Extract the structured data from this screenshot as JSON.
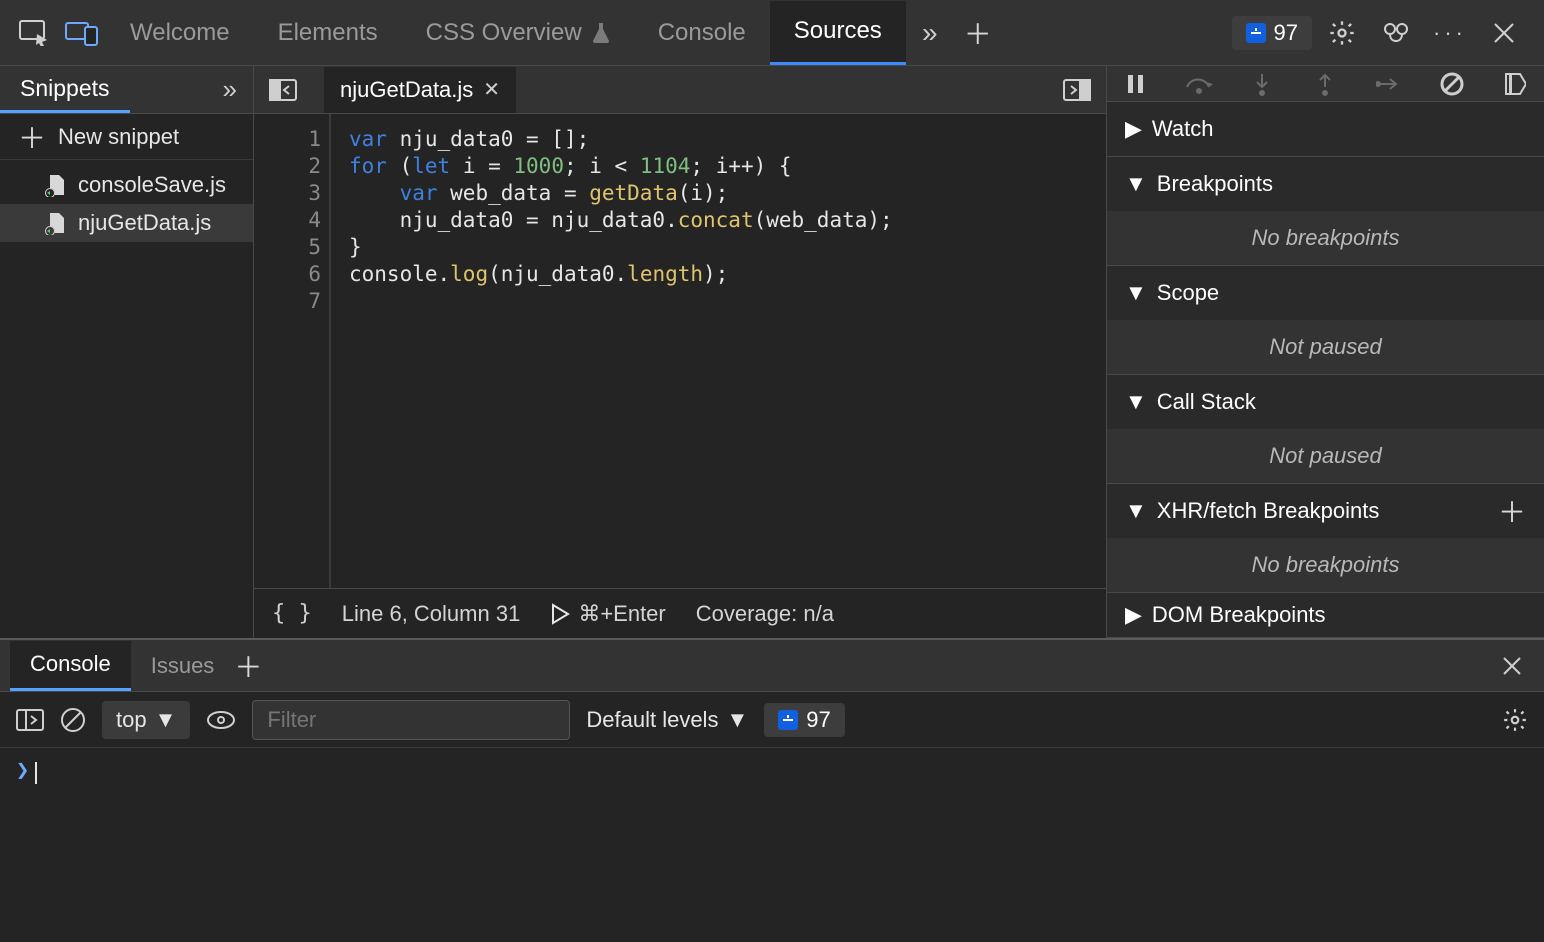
{
  "topbar": {
    "tabs": [
      "Welcome",
      "Elements",
      "CSS Overview",
      "Console",
      "Sources"
    ],
    "active_tab": "Sources",
    "issues_count": "97"
  },
  "navigator": {
    "tab_label": "Snippets",
    "new_snippet_label": "New snippet",
    "snippets": [
      "consoleSave.js",
      "njuGetData.js"
    ],
    "selected": "njuGetData.js"
  },
  "editor": {
    "open_file": "njuGetData.js",
    "gutter": [
      "1",
      "2",
      "3",
      "4",
      "5",
      "6",
      "7"
    ],
    "status_position": "Line 6, Column 31",
    "status_run_shortcut": "⌘+Enter",
    "status_coverage": "Coverage: n/a",
    "code_tokens": [
      [
        [
          "kw",
          "var"
        ],
        [
          "",
          " nju_data0 = [];"
        ]
      ],
      [
        [
          "kw",
          "for"
        ],
        [
          "",
          " ("
        ],
        [
          "let",
          "let"
        ],
        [
          "",
          " i = "
        ],
        [
          "num",
          "1000"
        ],
        [
          "",
          ";"
        ],
        [
          "",
          " i < "
        ],
        [
          "num",
          "1104"
        ],
        [
          "",
          "; i++) {"
        ]
      ],
      [
        [
          "",
          "    "
        ],
        [
          "kw",
          "var"
        ],
        [
          "",
          " web_data = "
        ],
        [
          "fn",
          "getData"
        ],
        [
          "",
          "(i);"
        ]
      ],
      [
        [
          "",
          "    nju_data0 = nju_data0."
        ],
        [
          "fn",
          "concat"
        ],
        [
          "",
          "(web_data);"
        ]
      ],
      [
        [
          "",
          "}"
        ]
      ],
      [
        [
          "",
          "console."
        ],
        [
          "fn",
          "log"
        ],
        [
          "",
          "(nju_data0."
        ],
        [
          "fn",
          "length"
        ],
        [
          "",
          ");"
        ]
      ],
      [
        [
          "",
          ""
        ]
      ]
    ]
  },
  "debugger": {
    "sections": {
      "watch": "Watch",
      "breakpoints": "Breakpoints",
      "breakpoints_empty": "No breakpoints",
      "scope": "Scope",
      "scope_empty": "Not paused",
      "callstack": "Call Stack",
      "callstack_empty": "Not paused",
      "xhr": "XHR/fetch Breakpoints",
      "xhr_empty": "No breakpoints",
      "dom": "DOM Breakpoints"
    }
  },
  "drawer": {
    "tabs": [
      "Console",
      "Issues"
    ],
    "active_tab": "Console",
    "context": "top",
    "filter_placeholder": "Filter",
    "levels_label": "Default levels",
    "issues_count": "97"
  }
}
